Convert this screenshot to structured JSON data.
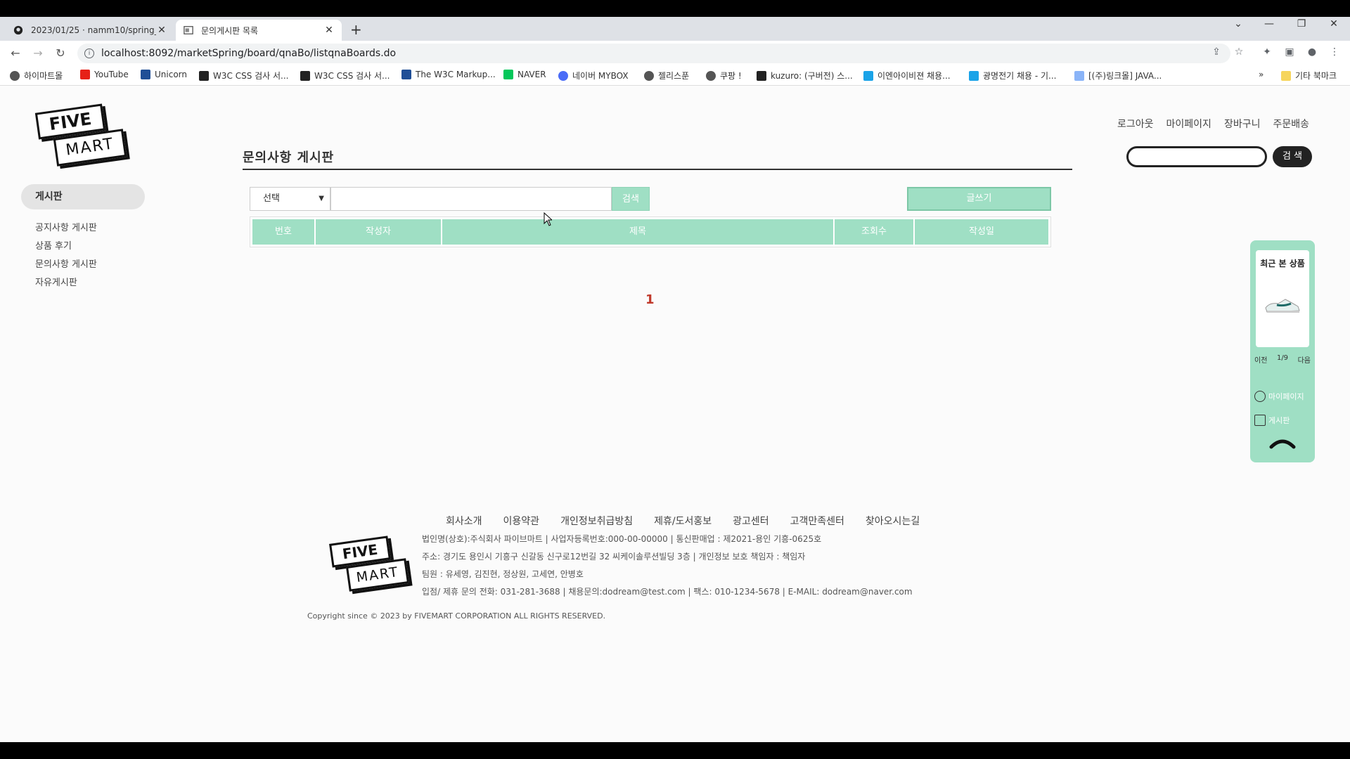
{
  "browser": {
    "tabs": [
      {
        "title": "2023/01/25 · namm10/spring_p",
        "icon": "github-icon"
      },
      {
        "title": "문의게시판 목록",
        "icon": "page-icon"
      }
    ],
    "url": "localhost:8092/marketSpring/board/qnaBo/listqnaBoards.do",
    "bookmarks": [
      "하이마트몰",
      "YouTube",
      "Unicorn",
      "W3C CSS 검사 서...",
      "W3C CSS 검사 서...",
      "The W3C Markup...",
      "NAVER",
      "네이버 MYBOX",
      "젤리스푼",
      "쿠팡 !",
      "kuzuro: (구버전) 스...",
      "이엔아이비젼 채용...",
      "광명전기 채용 - 기...",
      "[(주)링크몰] JAVA..."
    ],
    "more_bookmarks": "»",
    "other_bookmarks": "기타 북마크"
  },
  "site": {
    "logo_top": "FIVE",
    "logo_bottom": "MART",
    "user_nav": [
      "로그아웃",
      "마이페이지",
      "장바구니",
      "주문배송"
    ],
    "search_btn": "검 색"
  },
  "sidebar": {
    "title": "게시판",
    "items": [
      "공지사항 게시판",
      "상품 후기",
      "문의사항 게시판",
      "자유게시판"
    ]
  },
  "board": {
    "title": "문의사항 게시판",
    "select_value": "선택",
    "search_btn": "검색",
    "write_btn": "글쓰기",
    "columns": [
      "번호",
      "작성자",
      "제목",
      "조회수",
      "작성일"
    ],
    "page": "1"
  },
  "recent": {
    "title": "최근 본 상품",
    "prev": "이전",
    "count": "1/9",
    "next": "다음",
    "mypage": "마이페이지",
    "board": "게시판"
  },
  "footer": {
    "nav": [
      "회사소개",
      "이용약관",
      "개인정보취급방침",
      "제휴/도서홍보",
      "광고센터",
      "고객만족센터",
      "찾아오시는길"
    ],
    "lines": [
      "법인명(상호):주식회사 파이브마트  |  사업자등록번호:000-00-00000  |  통신판매업 : 제2021-용인 기흥-0625호",
      "주소: 경기도 용인시 기흥구 신갈동 신구로12번길 32 씨케이솔루션빌딩 3층  |  개인정보 보호 책임자 : 책임자",
      "팀원 : 유세영, 김진현, 정상원, 고세연, 안병호",
      "입점/ 제휴 문의 전화: 031-281-3688  | 채용문의:dodream@test.com  |  팩스: 010-1234-5678  |  E-MAIL: dodream@naver.com"
    ],
    "copyright": "Copyright since © 2023 by FIVEMART CORPORATION ALL RIGHTS RESERVED."
  }
}
